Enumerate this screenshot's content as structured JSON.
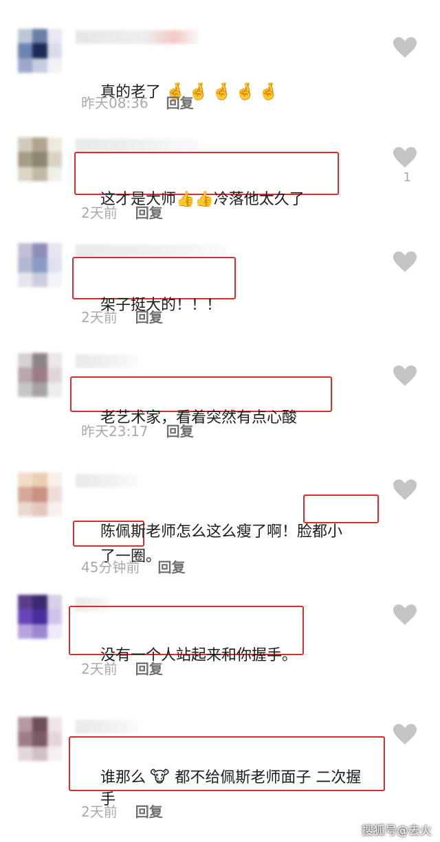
{
  "comments": [
    {
      "text": "真的老了",
      "emojis": "🤞🤞🤞🤞🤞",
      "time": "昨天08:36",
      "reply": "回复",
      "likes": "",
      "avatar_colors": [
        "#bcc6d6",
        "#6a7ea6",
        "#e6e9f1",
        "#6d84b3",
        "#1d2a55",
        "#d8dce8",
        "#9aa9c8",
        "#c6cde0",
        "#f0f2f6"
      ]
    },
    {
      "text": "这才是大师",
      "text_after": "冷落他太久了",
      "emojis": "👍👍",
      "time": "2天前",
      "reply": "回复",
      "likes": "1",
      "avatar_colors": [
        "#cfcbbb",
        "#aea58d",
        "#ece9df",
        "#a39c86",
        "#8f8670",
        "#d7d2c3",
        "#d9d5c8",
        "#c0b9a6",
        "#f1efe9"
      ]
    },
    {
      "text": "架子挺大的！！！",
      "time": "2天前",
      "reply": "回复",
      "likes": "",
      "avatar_colors": [
        "#c2bfd6",
        "#8f8db6",
        "#e7e6f0",
        "#b4b7d2",
        "#8c9bc6",
        "#dfe2ef",
        "#e4e5ee",
        "#c9cde0",
        "#f4f4f8"
      ]
    },
    {
      "text": "老艺术家，看着突然有点心酸",
      "time": "昨天23:17",
      "reply": "回复",
      "likes": "",
      "avatar_colors": [
        "#d6d1d3",
        "#8e8488",
        "#ebe7e8",
        "#b8a7ab",
        "#9c7c84",
        "#e0d6d8",
        "#c7c4c6",
        "#a7a2a5",
        "#eeeced"
      ]
    },
    {
      "text": "陈佩斯老师怎么这么瘦了啊！",
      "text_box": "脸都小",
      "text_line2": "了一圈。",
      "time": "45分钟前",
      "reply": "回复",
      "likes": "",
      "avatar_colors": [
        "#f0dcc7",
        "#e9cfb4",
        "#f8efe6",
        "#d7a89a",
        "#c98f80",
        "#efdcd6",
        "#ecd8d0",
        "#e5c8bd",
        "#f8f0ec"
      ]
    },
    {
      "text": "没有一个人站起来和你握手。",
      "time": "2天前",
      "reply": "回复",
      "likes": "",
      "avatar_colors": [
        "#5a3e8c",
        "#3c2a6e",
        "#d8cfe8",
        "#6b45b8",
        "#4a2f9a",
        "#cfc2ea",
        "#b7a3dd",
        "#9d85d0",
        "#efeaf7"
      ]
    },
    {
      "text": "谁那么",
      "emoji_mid": "🐮",
      "text_after": "都不给佩斯老师面子 二次握",
      "text_line2": "手",
      "time": "2天前",
      "reply": "回复",
      "likes": "",
      "avatar_colors": [
        "#b69aa2",
        "#6e4e58",
        "#ede5e8",
        "#9f7c86",
        "#7a5a64",
        "#e3d6da",
        "#e2d8db",
        "#cfc0c5",
        "#f5f0f2"
      ]
    }
  ],
  "watermark": "搜狐号@去火",
  "colors": {
    "highlight": "#d92b2b",
    "meta": "#a9a9a9",
    "reply": "#6e6e6e",
    "heart": "#c4c4c4"
  }
}
